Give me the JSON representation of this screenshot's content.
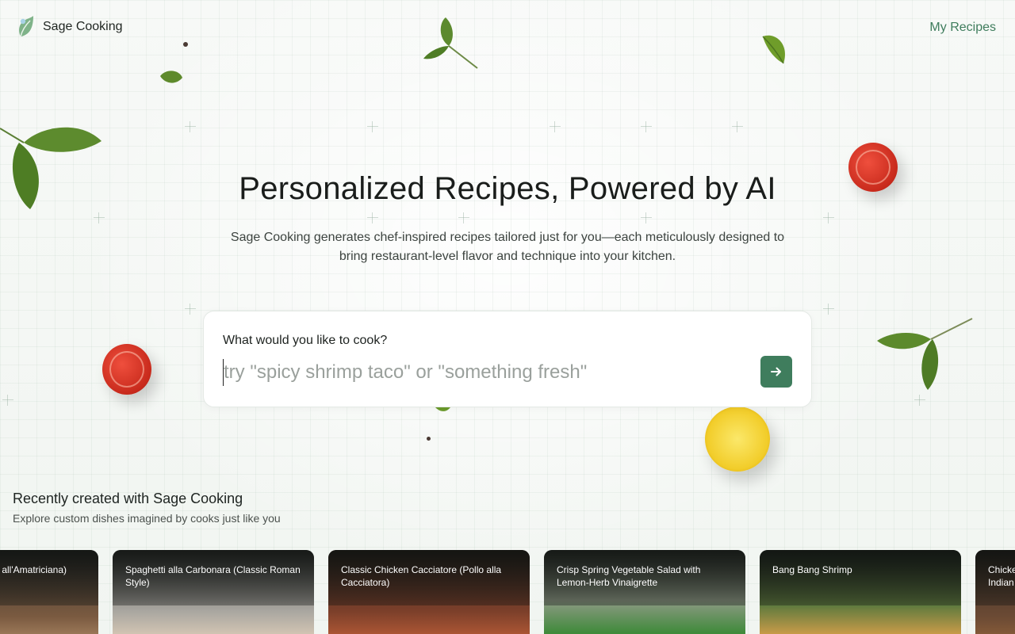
{
  "header": {
    "brand_name": "Sage Cooking",
    "nav_link": "My Recipes",
    "logo_icon": "leaf-icon"
  },
  "hero": {
    "title": "Personalized Recipes, Powered by AI",
    "subtitle": "Sage Cooking generates chef-inspired recipes tailored just for you—each meticulously designed to bring restaurant-level flavor and technique into your kitchen."
  },
  "search": {
    "label": "What would you like to cook?",
    "placeholder": "try \"spicy shrimp taco\" or \"something fresh\"",
    "value": "",
    "submit_icon": "arrow-right-icon"
  },
  "recent": {
    "title": "Recently created with Sage Cooking",
    "subtitle": "Explore custom dishes imagined by cooks just like you",
    "cards": [
      {
        "title": "all'Amatriciana)"
      },
      {
        "title": "Spaghetti alla Carbonara (Classic Roman Style)"
      },
      {
        "title": "Classic Chicken Cacciatore (Pollo alla Cacciatora)"
      },
      {
        "title": "Crisp Spring Vegetable Salad with Lemon-Herb Vinaigrette"
      },
      {
        "title": "Bang Bang Shrimp"
      },
      {
        "title": "Chicke Indian"
      }
    ]
  },
  "colors": {
    "accent": "#3f7d5d",
    "background": "#f6f8f6",
    "card_bg": "#ffffff"
  }
}
